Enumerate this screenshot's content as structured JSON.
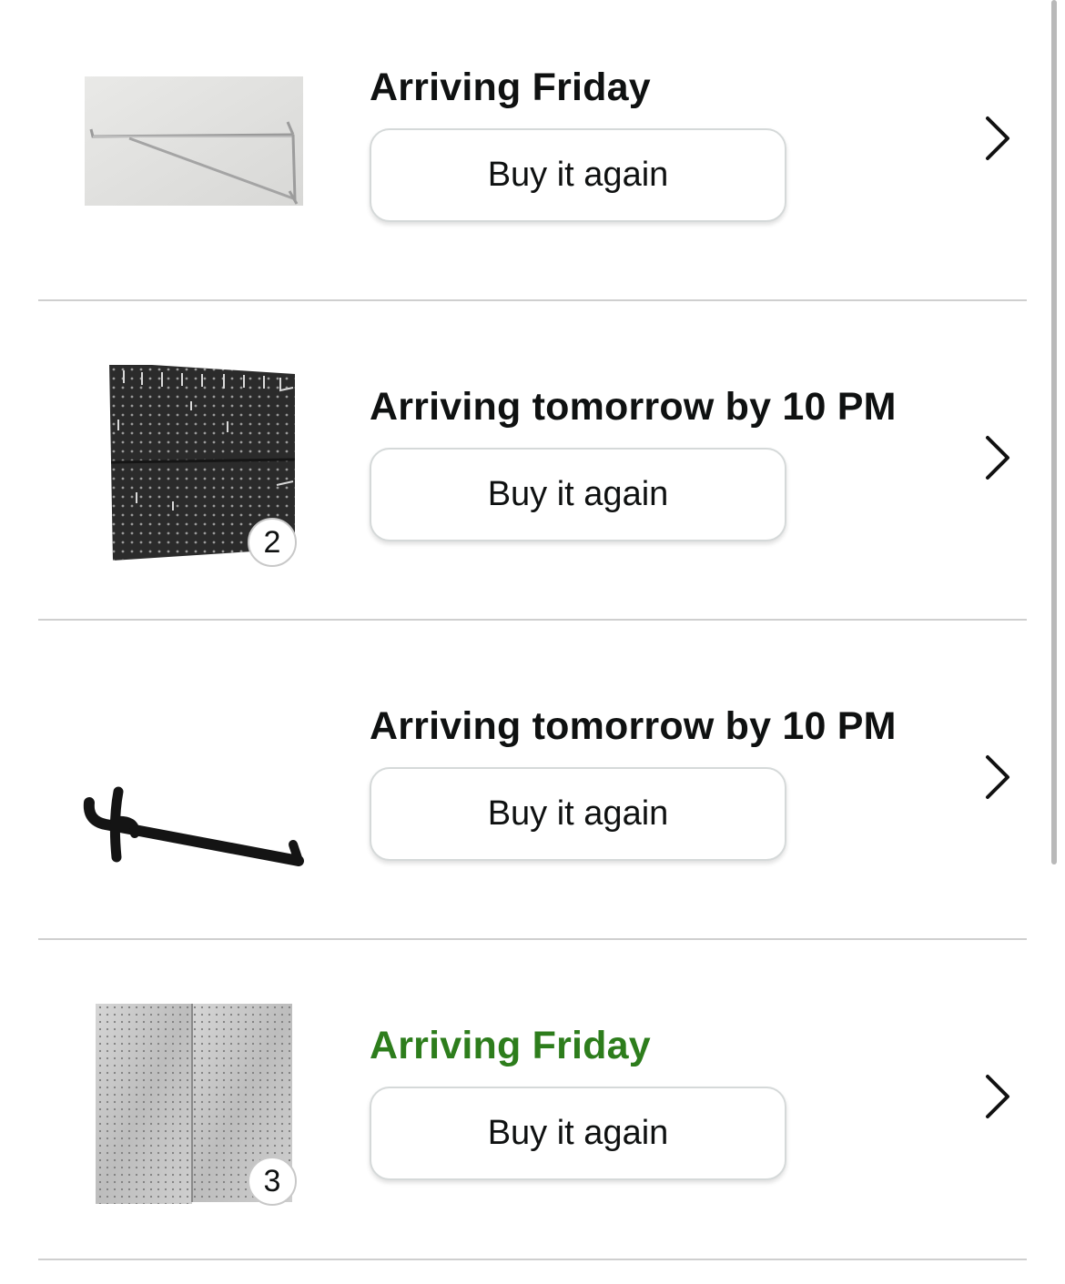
{
  "orders": [
    {
      "status": "Arriving Friday",
      "status_color": "#0f1111",
      "button_label": "Buy it again",
      "quantity": "",
      "image_icon": "pegboard-shelf-bracket-image"
    },
    {
      "status": "Arriving tomorrow by 10 PM",
      "status_color": "#0f1111",
      "button_label": "Buy it again",
      "quantity": "2",
      "image_icon": "black-pegboard-panel-image"
    },
    {
      "status": "Arriving tomorrow by 10 PM",
      "status_color": "#0f1111",
      "button_label": "Buy it again",
      "quantity": "",
      "image_icon": "black-peg-hook-image"
    },
    {
      "status": "Arriving Friday",
      "status_color": "#2d7d1c",
      "button_label": "Buy it again",
      "quantity": "3",
      "image_icon": "galvanized-pegboard-panels-image"
    }
  ],
  "chevron_icon": "chevron-right-icon",
  "colors": {
    "divider": "#cfcfcf",
    "button_border": "#d5d9d9",
    "text": "#0f1111",
    "green_status": "#2d7d1c"
  }
}
